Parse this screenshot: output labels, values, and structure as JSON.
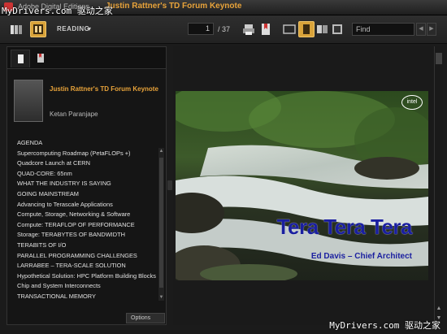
{
  "window": {
    "app_name": "Adobe Digital Editions",
    "doc_title": "Justin Rattner's TD Forum Keynote"
  },
  "watermark": {
    "top": "MyDrivers.com 驱动之家",
    "bottom": "MyDrivers.com 驱动之家"
  },
  "toolbar": {
    "view_mode": "READING",
    "page_current": "1",
    "page_total": "/ 37",
    "find_placeholder": "Find"
  },
  "document": {
    "title": "Justin Rattner's TD Forum Keynote",
    "author": "Ketan Paranjape"
  },
  "toc": [
    "AGENDA",
    "Supercomputing Roadmap (PetaFLOPs +)",
    "Quadcore Launch at CERN",
    "QUAD-CORE: 65nm",
    "WHAT THE INDUSTRY IS SAYING",
    "GOING MAINSTREAM",
    "Advancing to Terascale Applications",
    "Compute, Storage, Networking & Software",
    "Compute: TERAFLOP OF PERFORMANCE",
    "Storage: TERABYTES OF BANDWIDTH",
    "TERABITS OF I/O",
    "PARALLEL PROGRAMMING CHALLENGES",
    "LARRABEE – TERA-SCALE SOLUTION",
    "Hypothetical Solution: HPC Platform Building Blocks",
    "Chip and System Interconnects",
    "TRANSACTIONAL MEMORY"
  ],
  "sidebar": {
    "options_label": "Options"
  },
  "slide": {
    "title": "Tera Tera Tera",
    "subtitle": "Ed Davis – Chief Architect",
    "logo": "intel"
  },
  "colors": {
    "accent": "#e8a33a",
    "slide_text": "#1a1fa0"
  }
}
